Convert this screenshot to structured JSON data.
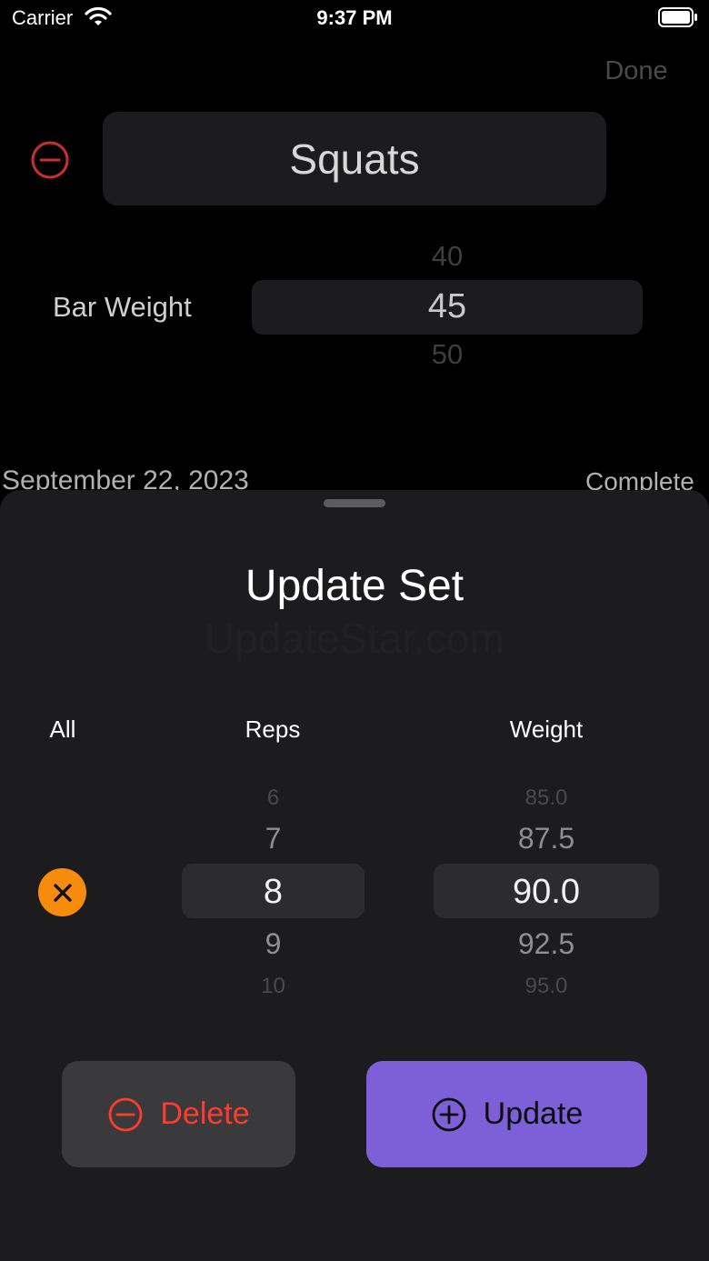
{
  "status_bar": {
    "carrier": "Carrier",
    "time": "9:37 PM"
  },
  "editor": {
    "done_label": "Done",
    "exercise_name": "Squats",
    "bar_weight_label": "Bar Weight",
    "bar_weight_options": [
      "40",
      "45",
      "50"
    ],
    "bar_weight_selected": "45",
    "date": "September 22, 2023",
    "status": "Complete"
  },
  "sheet": {
    "title": "Update Set",
    "watermark": "UpdateStar.com",
    "columns": {
      "all": "All",
      "reps": "Reps",
      "weight": "Weight"
    },
    "reps_options": [
      "6",
      "7",
      "8",
      "9",
      "10"
    ],
    "reps_selected": "8",
    "weight_options": [
      "85.0",
      "87.5",
      "90.0",
      "92.5",
      "95.0"
    ],
    "weight_selected": "90.0",
    "delete_label": "Delete",
    "update_label": "Update"
  },
  "colors": {
    "accent_purple": "#7d5fd8",
    "destructive_red": "#ff3b30",
    "clear_orange": "#f78c0c",
    "sheet_background": "#1c1c1e"
  },
  "icons": {
    "remove_exercise": "minus-circle-icon",
    "clear_all": "x-mark-icon",
    "delete": "minus-circle-icon",
    "update": "plus-circle-icon"
  }
}
